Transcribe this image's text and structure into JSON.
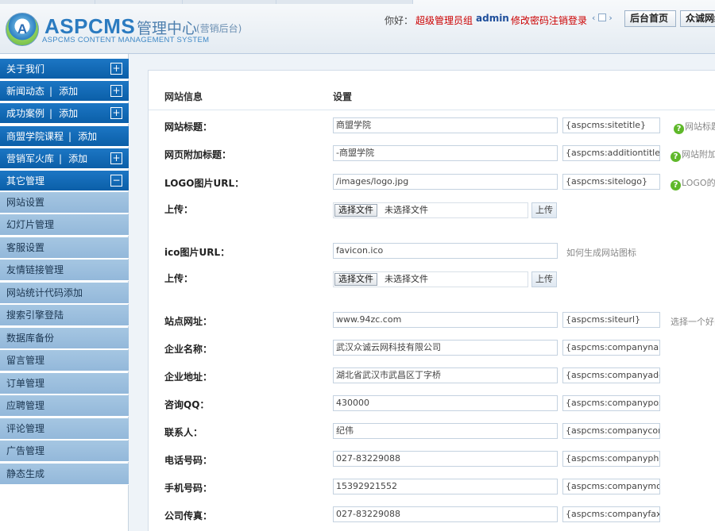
{
  "header": {
    "logo_letter": "A",
    "logo_title": "ASPCMS",
    "logo_center": "管理中心",
    "logo_sub": "(营销后台)",
    "logo_en": "ASPCMS CONTENT MANAGEMENT SYSTEM",
    "hello": "你好：",
    "role": "超级管理员组",
    "username": "admin",
    "change_password": "修改密码",
    "logout": "注销登录",
    "home_button": "后台首页",
    "site_button": "众诚网络"
  },
  "sidebar": {
    "about": "关于我们",
    "news": "新闻动态",
    "news_add": "添加",
    "cases": "成功案例",
    "cases_add": "添加",
    "courses": "商盟学院课程",
    "courses_add": "添加",
    "arsenal": "营销军火库",
    "arsenal_add": "添加",
    "other": "其它管理",
    "plus": "+",
    "minus": "−",
    "items": [
      "网站设置",
      "幻灯片管理",
      "客服设置",
      "友情链接管理",
      "网站统计代码添加",
      "搜索引擎登陆",
      "数据库备份",
      "留言管理",
      "订单管理",
      "应聘管理",
      "评论管理",
      "广告管理",
      "静态生成"
    ]
  },
  "form": {
    "col_info": "网站信息",
    "col_setting": "设置",
    "choose_file": "选择文件",
    "no_file": "未选择文件",
    "upload": "上传",
    "rows": {
      "sitetitle": {
        "label": "网站标题：",
        "value": "商盟学院",
        "tag": "{aspcms:sitetitle}",
        "hint": "网站标题"
      },
      "additiontitle": {
        "label": "网页附加标题：",
        "value": "-商盟学院",
        "tag": "{aspcms:additiontitle}",
        "hint": "网站附加"
      },
      "sitelogo": {
        "label": "LOGO图片URL：",
        "value": "/images/logo.jpg",
        "tag": "{aspcms:sitelogo}",
        "hint": "LOGO的"
      },
      "upload1": {
        "label": "上传："
      },
      "ico": {
        "label": "ico图片URL：",
        "value": "favicon.ico",
        "hint": "如何生成网站图标"
      },
      "upload2": {
        "label": "上传："
      },
      "siteurl": {
        "label": "站点网址：",
        "value": "www.94zc.com",
        "tag": "{aspcms:siteurl}",
        "hint": "选择一个好的"
      },
      "companyname": {
        "label": "企业名称：",
        "value": "武汉众诚云网科技有限公司",
        "tag": "{aspcms:companyname}"
      },
      "companyaddr": {
        "label": "企业地址：",
        "value": "湖北省武汉市武昌区丁字桥",
        "tag": "{aspcms:companyaddress}"
      },
      "companyqq": {
        "label": "咨询QQ：",
        "value": "430000",
        "tag": "{aspcms:companypostcode}"
      },
      "contact": {
        "label": "联系人：",
        "value": "纪伟",
        "tag": "{aspcms:companycontact}"
      },
      "phone": {
        "label": "电话号码：",
        "value": "027-83229088",
        "tag": "{aspcms:companyphone}"
      },
      "mobile": {
        "label": "手机号码：",
        "value": "15392921552",
        "tag": "{aspcms:companymobile}"
      },
      "fax": {
        "label": "公司传真：",
        "value": "027-83229088",
        "tag": "{aspcms:companyfax}"
      }
    }
  }
}
